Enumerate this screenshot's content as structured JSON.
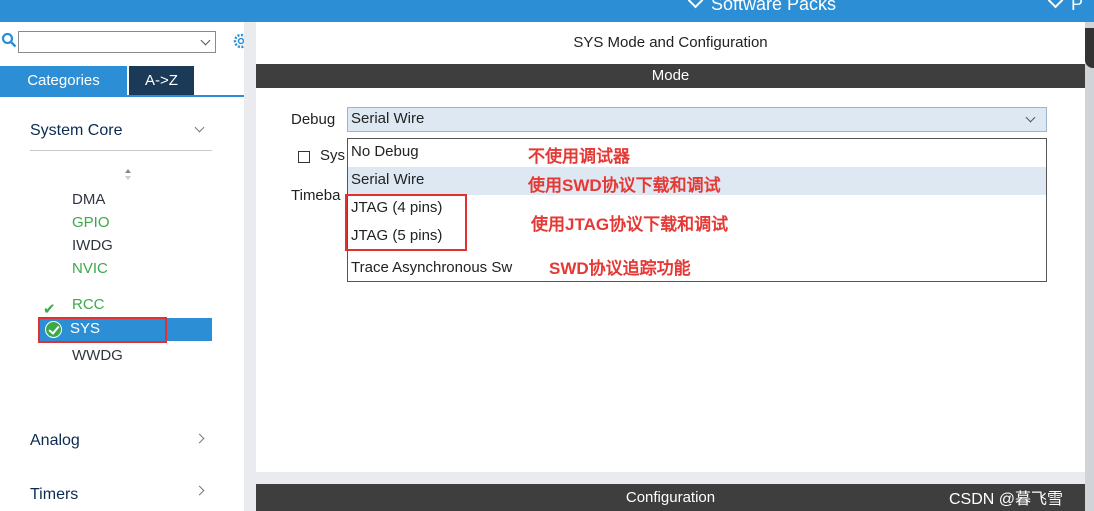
{
  "topbar": {
    "software_packs": "Software Packs",
    "pinout": "P"
  },
  "sidebar": {
    "search": {
      "value": "",
      "placeholder": ""
    },
    "tabs": {
      "categories": "Categories",
      "az": "A->Z"
    },
    "groups": {
      "system_core": "System Core",
      "analog": "Analog",
      "timers": "Timers"
    },
    "components": {
      "dma": "DMA",
      "gpio": "GPIO",
      "iwdg": "IWDG",
      "nvic": "NVIC",
      "rcc": "RCC",
      "sys": "SYS",
      "wwdg": "WWDG"
    }
  },
  "main": {
    "title": "SYS Mode and Configuration",
    "mode_header": "Mode",
    "config_header": "Configuration",
    "debug_label": "Debug",
    "debug_value": "Serial Wire",
    "checkbox_label": "Sys",
    "timebase_label": "Timeba",
    "debug_options": [
      {
        "label": "No Debug",
        "note": "不使用调试器"
      },
      {
        "label": "Serial Wire",
        "note": "使用SWD协议下载和调试"
      },
      {
        "label": "JTAG (4 pins)",
        "note": ""
      },
      {
        "label": "JTAG (5 pins)",
        "note": ""
      },
      {
        "label": "Trace Asynchronous Sw",
        "note": "SWD协议追踪功能"
      }
    ],
    "jtag_note": "使用JTAG协议下载和调试"
  },
  "watermark": "CSDN @暮飞雪",
  "colors": {
    "accent": "#2c8fd6",
    "dark_bar": "#3e3e3e",
    "green": "#3ba94a",
    "annotation_red": "#e53935"
  }
}
